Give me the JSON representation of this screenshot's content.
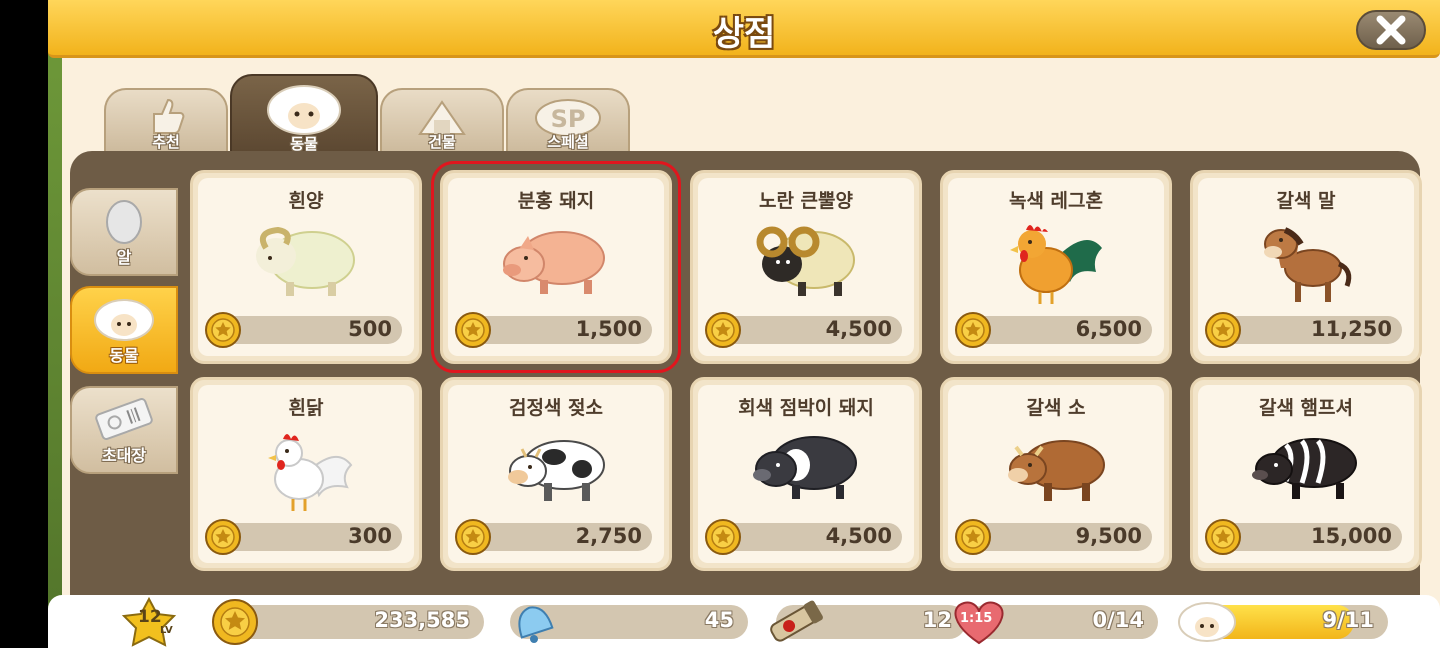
{
  "header": {
    "title": "상점"
  },
  "tabs": [
    {
      "label": "추천",
      "icon": "thumbs-up-icon"
    },
    {
      "label": "동물",
      "icon": "sheep-icon",
      "active": true
    },
    {
      "label": "건물",
      "icon": "building-icon"
    },
    {
      "label": "스페셜",
      "icon": "sp-icon"
    }
  ],
  "side_tabs": [
    {
      "label": "알",
      "icon": "egg-icon"
    },
    {
      "label": "동물",
      "icon": "sheep-icon",
      "active": true
    },
    {
      "label": "초대장",
      "icon": "ticket-icon"
    }
  ],
  "items": [
    {
      "name": "흰양",
      "price": "500",
      "icon": "white-sheep-icon"
    },
    {
      "name": "분홍 돼지",
      "price": "1,500",
      "icon": "pink-pig-icon",
      "selected": true
    },
    {
      "name": "노란 큰뿔양",
      "price": "4,500",
      "icon": "bighorn-sheep-icon"
    },
    {
      "name": "녹색 레그혼",
      "price": "6,500",
      "icon": "rooster-icon"
    },
    {
      "name": "갈색 말",
      "price": "11,250",
      "icon": "brown-horse-icon"
    },
    {
      "name": "흰닭",
      "price": "300",
      "icon": "white-chicken-icon"
    },
    {
      "name": "검정색 젖소",
      "price": "2,750",
      "icon": "dairy-cow-icon"
    },
    {
      "name": "회색 점박이 돼지",
      "price": "4,500",
      "icon": "spotted-pig-icon"
    },
    {
      "name": "갈색 소",
      "price": "9,500",
      "icon": "brown-cow-icon"
    },
    {
      "name": "갈색 햄프셔",
      "price": "15,000",
      "icon": "hampshire-pig-icon"
    }
  ],
  "status": {
    "level": "12",
    "level_suffix": "LV",
    "coins": "233,585",
    "bells": "45",
    "items": "12",
    "hearts_timer": "1:15",
    "hearts": "0/14",
    "animals": "9/11",
    "animals_fill": 0.82
  },
  "colors": {
    "header": "#f2b31c",
    "panel": "#6e5c46",
    "selected_outline": "#e0161e",
    "coin": "#f0b820"
  }
}
